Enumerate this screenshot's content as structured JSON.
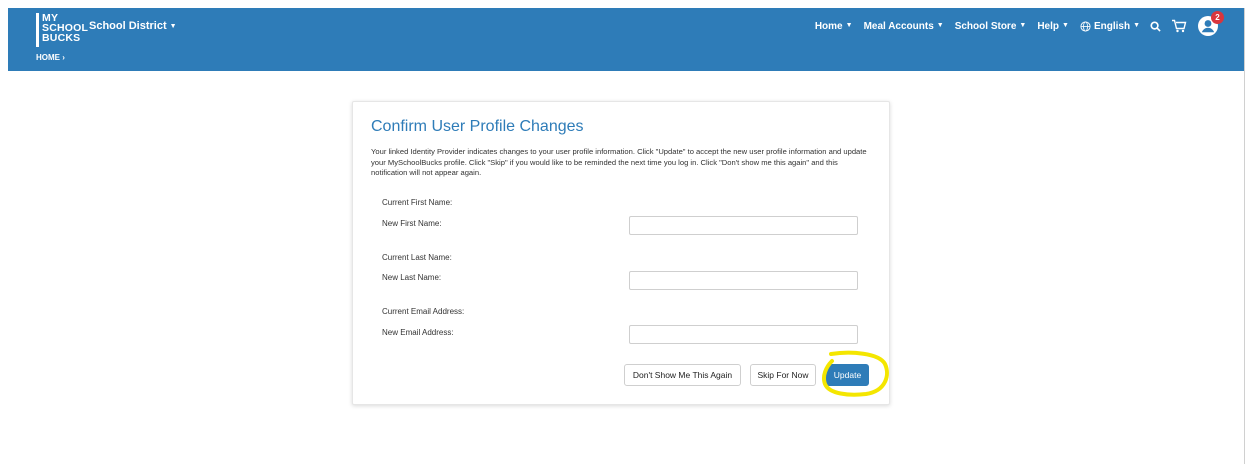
{
  "header": {
    "logo_lines": [
      "MY",
      "SCHOOL",
      "BUCKS"
    ],
    "district": "School District",
    "breadcrumb": "HOME ›",
    "nav": [
      {
        "label": "Home",
        "has_caret": true
      },
      {
        "label": "Meal Accounts",
        "has_caret": true
      },
      {
        "label": "School Store",
        "has_caret": true
      },
      {
        "label": "Help",
        "has_caret": true
      },
      {
        "label": "English",
        "has_caret": true
      }
    ],
    "notification_count": "2",
    "colors": {
      "bar": "#2e7cb8",
      "badge": "#d9363e"
    }
  },
  "dialog": {
    "title": "Confirm User Profile Changes",
    "description": "Your linked Identity Provider indicates changes to your user profile information. Click \"Update\" to accept the new user profile information and update your MySchoolBucks profile. Click \"Skip\" if you would like to be reminded the next time you log in. Click \"Don't show me this again\" and this notification will not appear again.",
    "current_first_name_label": "Current First Name:",
    "new_first_name_label": "New First Name:",
    "current_last_name_label": "Current Last Name:",
    "new_last_name_label": "New Last Name:",
    "current_email_label": "Current Email Address:",
    "new_email_label": "New Email Address:",
    "new_first_name_value": "",
    "new_last_name_value": "",
    "new_email_value": "",
    "buttons": {
      "dont_show": "Don't Show Me This Again",
      "skip": "Skip For Now",
      "update": "Update"
    }
  },
  "icons": [
    "globe-icon",
    "search-icon",
    "cart-icon",
    "user-icon",
    "chevron-down-icon"
  ],
  "accent": {
    "highlight": "#f4e600"
  }
}
